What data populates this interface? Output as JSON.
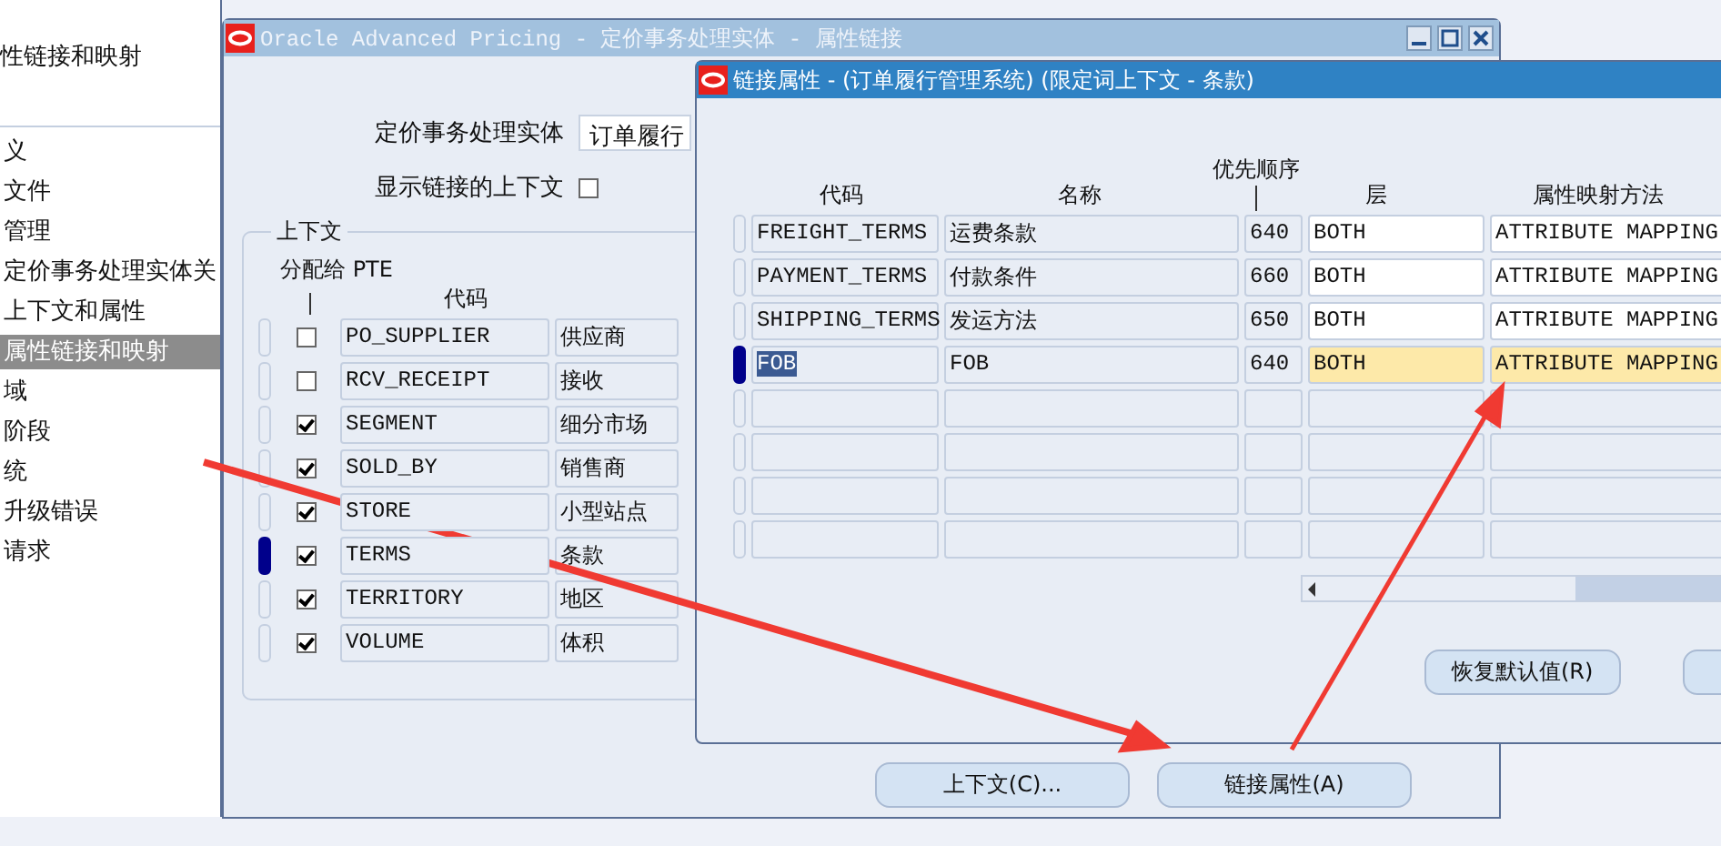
{
  "sidebar": {
    "title": "性链接和映射",
    "items": [
      {
        "label": "义",
        "selected": false
      },
      {
        "label": "文件",
        "selected": false
      },
      {
        "label": "管理",
        "selected": false
      },
      {
        "label": "定价事务处理实体关",
        "selected": false
      },
      {
        "label": "上下文和属性",
        "selected": false
      },
      {
        "label": "属性链接和映射",
        "selected": true
      },
      {
        "label": "域",
        "selected": false
      },
      {
        "label": "阶段",
        "selected": false
      },
      {
        "label": "统",
        "selected": false
      },
      {
        "label": "升级错误",
        "selected": false
      },
      {
        "label": "请求",
        "selected": false
      }
    ]
  },
  "main_window": {
    "title": "Oracle Advanced Pricing - 定价事务处理实体 - 属性链接",
    "entity_label": "定价事务处理实体",
    "entity_value": "订单履行",
    "show_linked_label": "显示链接的上下文",
    "show_linked_checked": false,
    "group_title": "上下文",
    "assigned_header": "分配给 PTE",
    "code_header": "代码",
    "rows": [
      {
        "assigned": false,
        "code": "PO_SUPPLIER",
        "name": "供应商",
        "selected": false
      },
      {
        "assigned": false,
        "code": "RCV_RECEIPT",
        "name": "接收",
        "selected": false
      },
      {
        "assigned": true,
        "code": "SEGMENT",
        "name": "细分市场",
        "selected": false
      },
      {
        "assigned": true,
        "code": "SOLD_BY",
        "name": "销售商",
        "selected": false
      },
      {
        "assigned": true,
        "code": "STORE",
        "name": "小型站点",
        "selected": false
      },
      {
        "assigned": true,
        "code": "TERMS",
        "name": "条款",
        "selected": true
      },
      {
        "assigned": true,
        "code": "TERRITORY",
        "name": "地区",
        "selected": false
      },
      {
        "assigned": true,
        "code": "VOLUME",
        "name": "体积",
        "selected": false
      }
    ],
    "buttons": [
      "上下文(C)...",
      "链接属性(A)"
    ]
  },
  "dialog": {
    "title": "链接属性 - (订单履行管理系统) (限定词上下文 - 条款)",
    "columns": [
      "代码",
      "名称",
      "优先顺序",
      "层",
      "属性映射方法"
    ],
    "rows": [
      {
        "code": "FREIGHT_TERMS",
        "name": "运费条款",
        "priority": "640",
        "level": "BOTH",
        "method": "ATTRIBUTE MAPPING",
        "selected": false
      },
      {
        "code": "PAYMENT_TERMS",
        "name": "付款条件",
        "priority": "660",
        "level": "BOTH",
        "method": "ATTRIBUTE MAPPING",
        "selected": false
      },
      {
        "code": "SHIPPING_TERMS",
        "name": "发运方法",
        "priority": "650",
        "level": "BOTH",
        "method": "ATTRIBUTE MAPPING",
        "selected": false
      },
      {
        "code": "FOB",
        "name": "FOB",
        "priority": "640",
        "level": "BOTH",
        "method": "ATTRIBUTE MAPPING",
        "selected": true
      }
    ],
    "button": "恢复默认值(R)"
  }
}
